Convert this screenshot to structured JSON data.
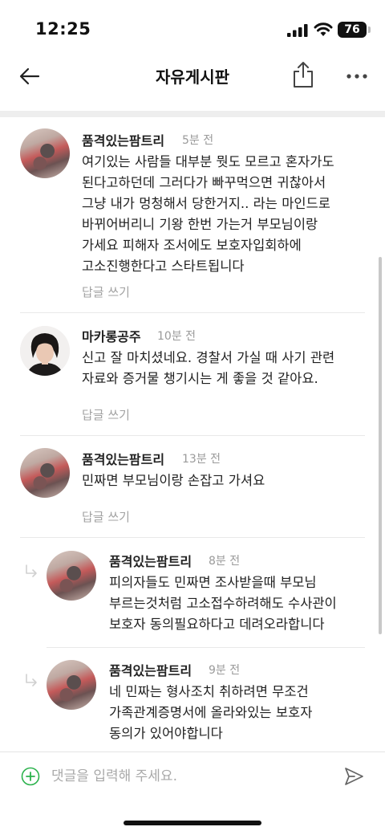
{
  "status_bar": {
    "time": "12:25",
    "battery": "76"
  },
  "header": {
    "title": "자유게시판"
  },
  "comments": [
    {
      "author": "품격있는팜트리",
      "time": "5분 전",
      "text": "여기있는 사람들 대부분 뭣도 모르고 혼자가도\n된다고하던데 그러다가 빠꾸먹으면 귀찮아서\n그냥 내가 멍청해서 당한거지.. 라는 마인드로\n바뀌어버리니 기왕 한번 가는거 부모님이랑\n가세요 피해자 조서에도 보호자입회하에\n고소진행한다고 스타트됩니다",
      "reply_label": "답글 쓰기"
    },
    {
      "author": "마카롱공주",
      "time": "10분 전",
      "text": "신고 잘 마치셨네요. 경찰서 가실 때 사기 관련\n자료와 증거물 챙기시는 게 좋을 것 같아요.",
      "reply_label": "답글 쓰기"
    },
    {
      "author": "품격있는팜트리",
      "time": "13분 전",
      "text": "민짜면 부모님이랑 손잡고 가셔요",
      "reply_label": "답글 쓰기"
    }
  ],
  "replies": [
    {
      "author": "품격있는팜트리",
      "time": "8분 전",
      "text": "피의자들도 민짜면 조사받을때 부모님\n부르는것처럼 고소접수하려해도 수사관이\n보호자 동의필요하다고 데려오라합니다"
    },
    {
      "author": "품격있는팜트리",
      "time": "9분 전",
      "text": "네 민짜는 형사조치 취하려면 무조건\n가족관계증명서에 올라와있는 보호자\n동의가 있어야합니다"
    }
  ],
  "input": {
    "placeholder": "댓글을 입력해 주세요."
  },
  "colors": {
    "accent_green": "#2bb24c",
    "muted": "#a3a3a3"
  }
}
